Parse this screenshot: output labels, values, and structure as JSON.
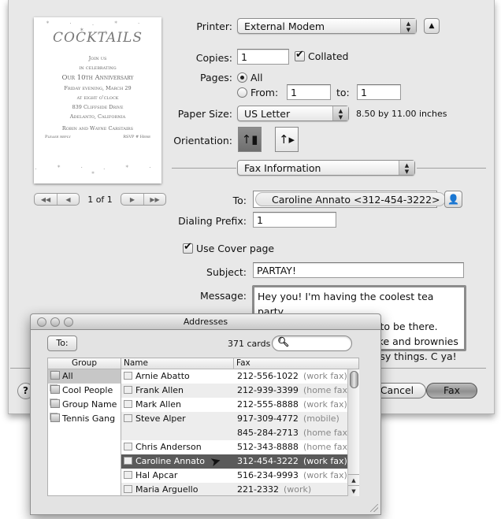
{
  "preview": {
    "title": "COCKTAILS",
    "lines": [
      "Join us",
      "in celebrating",
      "Our 10th Anniversary",
      "Friday evening, March 29",
      "at eight o'clock",
      "839 Cliffside Drive",
      "Adelanto, California",
      "Robin and Wayne Carstairs"
    ],
    "reply_left": "Please reply",
    "reply_right": "RSVP # Here",
    "pager": "1 of 1"
  },
  "print": {
    "printer_label": "Printer:",
    "printer_value": "External Modem",
    "copies_label": "Copies:",
    "copies_value": "1",
    "collated_label": "Collated",
    "collated_checked": true,
    "pages_label": "Pages:",
    "pages_all_label": "All",
    "pages_from_label": "From:",
    "pages_from_value": "1",
    "pages_to_label": "to:",
    "pages_to_value": "1",
    "pages_selected": "All",
    "paper_size_label": "Paper Size:",
    "paper_size_value": "US Letter",
    "paper_size_dims": "8.50 by 11.00 inches",
    "orientation_label": "Orientation:",
    "orientation_selected": "portrait",
    "section_value": "Fax Information"
  },
  "fax": {
    "to_label": "To:",
    "to_token": "Caroline Annato <312-454-3222>",
    "dialing_prefix_label": "Dialing Prefix:",
    "dialing_prefix_value": "1",
    "cover_label": "Use Cover page",
    "cover_checked": true,
    "subject_label": "Subject:",
    "subject_value": "PARTAY!",
    "message_label": "Message:",
    "message_lines": [
      "Hey you! I'm having the coolest tea party",
      "EVER and I need for you to be there.",
      "ake and brownies",
      "eesy things. C ya!"
    ]
  },
  "buttons": {
    "help": "?",
    "cancel": "Cancel",
    "fax": "Fax"
  },
  "addresses": {
    "title": "Addresses",
    "to_button": "To:",
    "card_count": "371 cards",
    "search_placeholder": "",
    "group_header": "Group",
    "name_header": "Name",
    "fax_header": "Fax",
    "groups": [
      "All",
      "Cool People",
      "Group Name",
      "Tennis Gang"
    ],
    "selected_group": "All",
    "rows": [
      {
        "name": "Arnie Abatto",
        "fax": "212-556-1022",
        "type": "(work fax)"
      },
      {
        "name": "Frank Allen",
        "fax": "212-939-3399",
        "type": "(home fax)"
      },
      {
        "name": "Mark Allen",
        "fax": "212-555-8888",
        "type": "(work fax)"
      },
      {
        "name": "Steve Alper",
        "fax": "917-309-4772",
        "type": "(mobile)"
      },
      {
        "name": "",
        "fax": "845-284-2713",
        "type": "(home fax)"
      },
      {
        "name": "Chris Anderson",
        "fax": "512-343-8888",
        "type": "(home fax)"
      },
      {
        "name": "Caroline Annato",
        "fax": "312-454-3222",
        "type": "(work fax)"
      },
      {
        "name": "Hal Apcar",
        "fax": "516-234-9993",
        "type": "(work fax)"
      },
      {
        "name": "Maria Arguello",
        "fax": "221-2332",
        "type": "(work)"
      }
    ],
    "selected_row": "Caroline Annato"
  }
}
